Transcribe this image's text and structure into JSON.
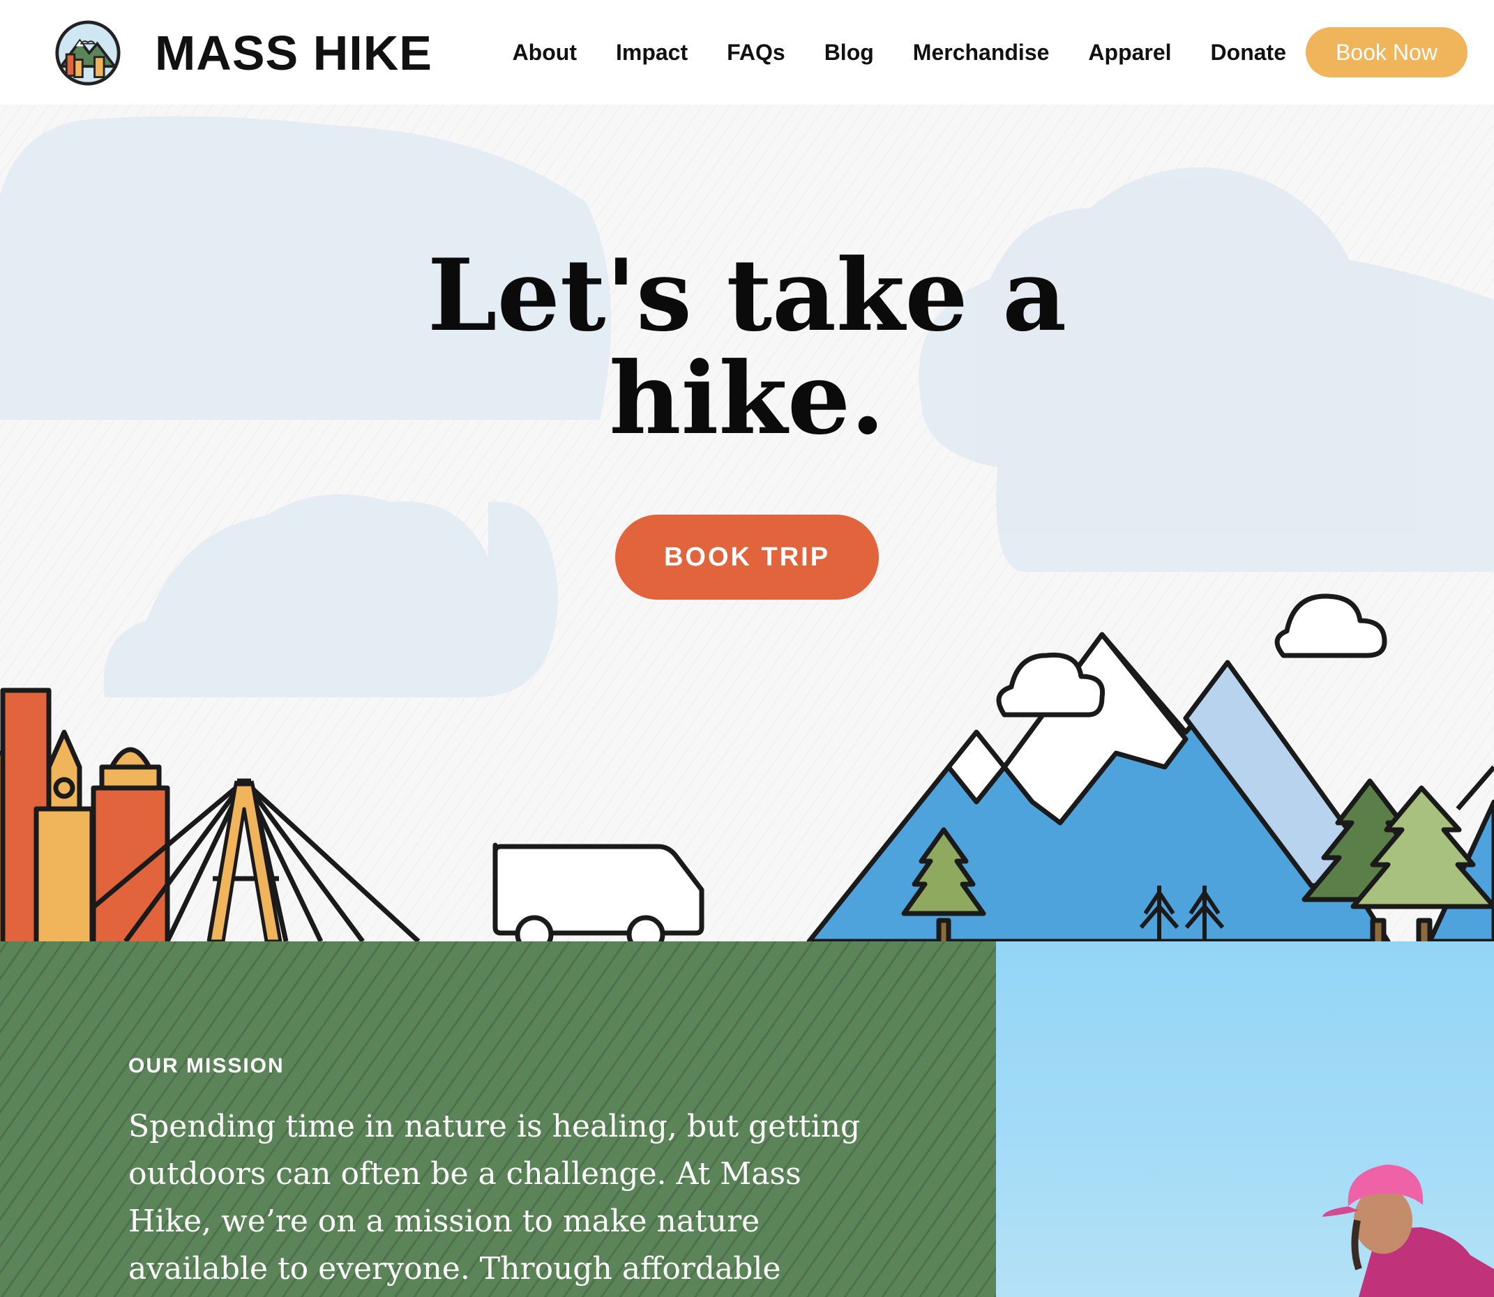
{
  "header": {
    "brand_name": "MASS HIKE",
    "nav": [
      "About",
      "Impact",
      "FAQs",
      "Blog",
      "Merchandise",
      "Apparel",
      "Donate"
    ],
    "cta_label": "Book Now"
  },
  "hero": {
    "title_line1": "Let's take a",
    "title_line2": "hike.",
    "cta_label": "BOOK TRIP"
  },
  "mission": {
    "eyebrow": "OUR MISSION",
    "text": "Spending time in nature is healing, but getting outdoors can often be a challenge. At Mass Hike, we’re on a mission to make nature available to everyone. Through affordable"
  },
  "icons": {
    "logo": "mountain-city-badge-icon",
    "van": "van-icon",
    "cloud": "cloud-icon",
    "tree": "pine-tree-icon"
  },
  "colors": {
    "accent_orange": "#e1643c",
    "accent_yellow": "#f0b45b",
    "mission_green": "#5b8458",
    "mountain_blue": "#4fa3dc",
    "sky_blue": "#a5dcf7"
  }
}
